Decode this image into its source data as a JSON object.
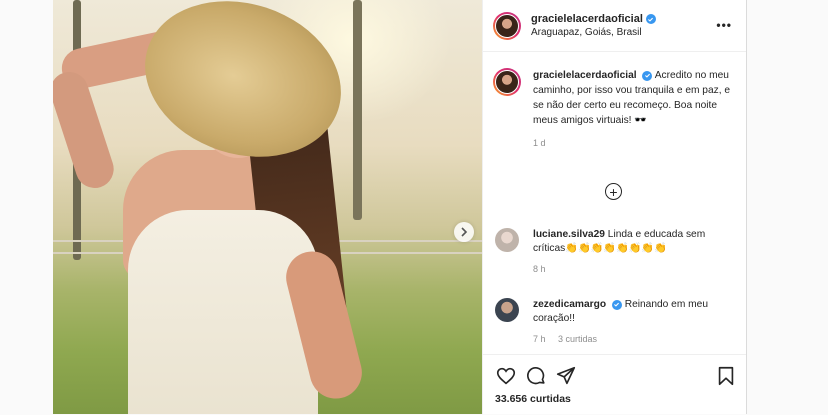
{
  "post": {
    "username": "gracielelacerdaoficial",
    "location": "Araguapaz, Goiás, Brasil",
    "more_label": "•••",
    "caption": "Acredito no meu caminho, por isso vou tranquila e em paz, e se não der certo eu recomeço. Boa noite meus amigos virtuais! 🕶️",
    "time": "1 d",
    "likes": "33.656 curtidas"
  },
  "comments": [
    {
      "username": "luciane.silva29",
      "text": "Linda e educada sem críticas👏👏👏👏👏👏👏👏",
      "time": "8 h",
      "likes": ""
    },
    {
      "username": "zezedicamargo",
      "text": "Reinando em meu coração!!",
      "time": "7 h",
      "likes": "3 curtidas"
    }
  ],
  "colors": {
    "verified": "#3897f0",
    "meta": "#8e8e8e",
    "text": "#262626"
  },
  "icons": [
    "heart-icon",
    "comment-icon",
    "share-icon",
    "bookmark-icon",
    "add-comment-icon",
    "chevron-right-icon",
    "verified-icon"
  ]
}
